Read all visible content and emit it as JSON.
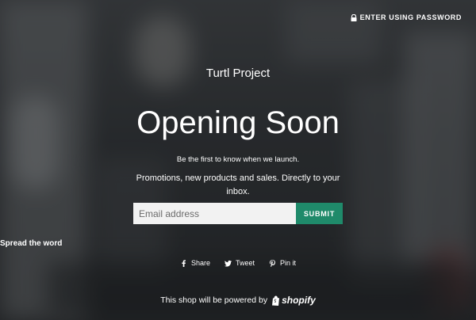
{
  "header": {
    "password_link": "ENTER USING PASSWORD",
    "lock_icon": "lock-icon"
  },
  "main": {
    "store_name": "Turtl Project",
    "headline": "Opening Soon",
    "tagline": "Be the first to know when we launch.",
    "description": "Promotions, new products and sales. Directly to your inbox.",
    "email_placeholder": "Email address",
    "submit_label": "SUBMIT"
  },
  "social": {
    "heading": "Spread the word",
    "items": [
      {
        "label": "Share",
        "icon": "facebook-icon"
      },
      {
        "label": "Tweet",
        "icon": "twitter-icon"
      },
      {
        "label": "Pin it",
        "icon": "pinterest-icon"
      }
    ]
  },
  "footer": {
    "text": "This shop will be powered by",
    "brand": "shopify",
    "brand_icon": "shopify-bag-icon"
  },
  "colors": {
    "submit_bg": "#1f8a6a",
    "input_bg": "#f2f2f2",
    "text": "#ffffff"
  }
}
